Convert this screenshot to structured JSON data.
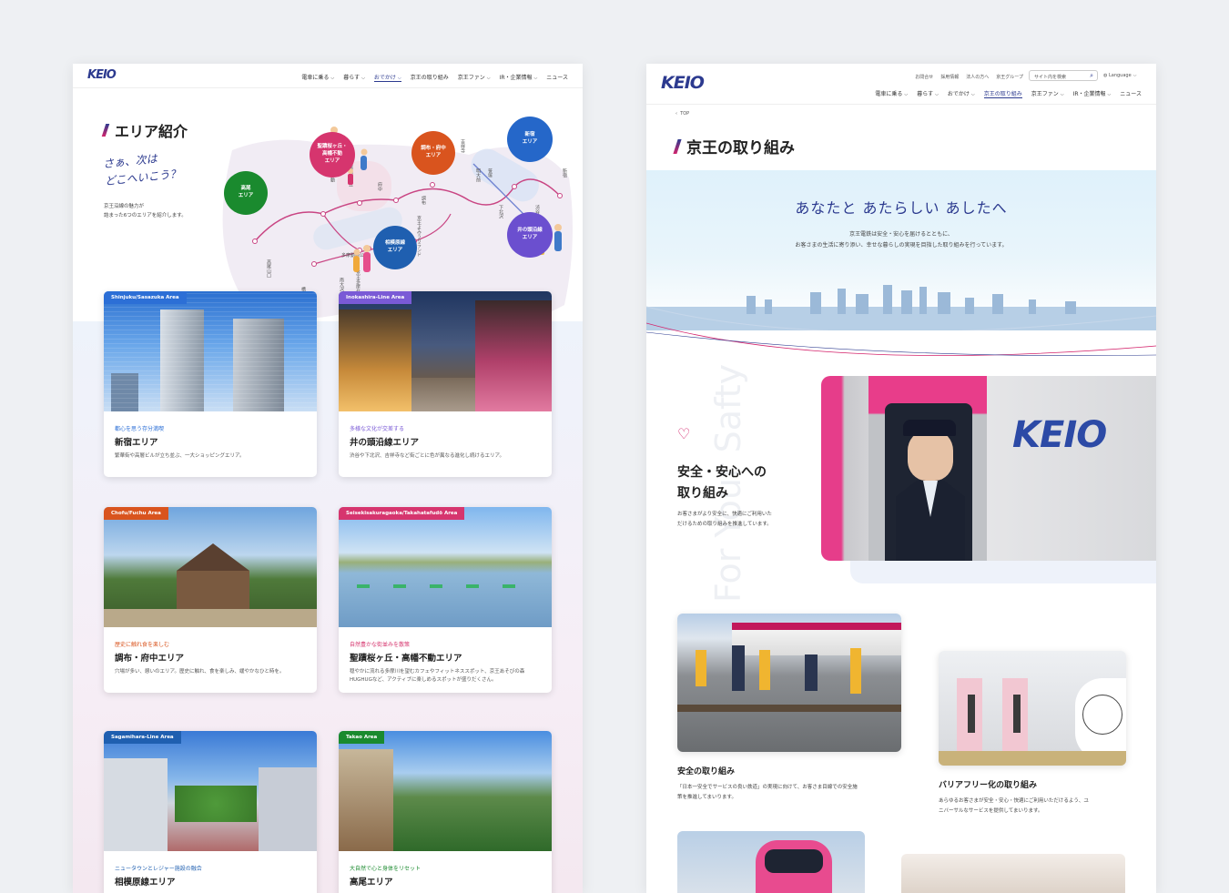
{
  "left": {
    "logo": "KEIO",
    "nav": [
      "電車に乗る",
      "暮らす",
      "おでかけ",
      "京王の取り組み",
      "京王ファン",
      "IR・企業情報",
      "ニュース"
    ],
    "title": "エリア紹介",
    "tagline": [
      "さぁ、次は",
      "どこへいこう？"
    ],
    "intro": [
      "京王沿線の魅力が",
      "詰まった6つのエリアを紹介します。"
    ],
    "bubbles": [
      {
        "label": "高尾\nエリア",
        "color": "#1a8a2e"
      },
      {
        "label": "聖蹟桜ヶ丘・\n高幡不動\nエリア",
        "color": "#d6356e"
      },
      {
        "label": "調布・府中\nエリア",
        "color": "#d9541e"
      },
      {
        "label": "新宿\nエリア",
        "color": "#2567c9"
      },
      {
        "label": "井の頭沿線\nエリア",
        "color": "#6b4fcf"
      },
      {
        "label": "相模原線\nエリア",
        "color": "#1f5fb0"
      }
    ],
    "stations": [
      "高尾山口",
      "高幡不動",
      "聖蹟桜ヶ丘",
      "府中",
      "調布",
      "明大前",
      "笹塚",
      "新宿",
      "吉祥寺",
      "下北沢",
      "渋谷",
      "多摩動物公園",
      "京王多摩センター",
      "京王よみうりランド",
      "南大沢",
      "橋本"
    ],
    "cards": [
      {
        "tag": "Shinjuku/Sasazuka Area",
        "tagColor": "#2c6fd6",
        "cat": "都心を思う存分満喫",
        "catColor": "#2c6fd6",
        "name": "新宿エリア",
        "desc": "繁華街や高層ビルが立ち並ぶ、一大ショッピングエリア。"
      },
      {
        "tag": "Inokashira-Line Area",
        "tagColor": "#7a5ad6",
        "cat": "多様な文化が交差する",
        "catColor": "#7a5ad6",
        "name": "井の頭沿線エリア",
        "desc": "渋谷や下北沢、吉祥寺など街ごとに色が異なる進化し続けるエリア。"
      },
      {
        "tag": "Chofu/Fuchu Area",
        "tagColor": "#d9541e",
        "cat": "歴史に触れ食を楽しむ",
        "catColor": "#d9541e",
        "name": "調布・府中エリア",
        "desc": "穴場が多い、憩いのエリア。歴史に触れ、食を楽しみ、緩やかなひと時を。"
      },
      {
        "tag": "Seisekisakuragaoka/Takahatafudō Area",
        "tagColor": "#d6356e",
        "cat": "自然豊かな街並みを散策",
        "catColor": "#d6356e",
        "name": "聖蹟桜ヶ丘・高幡不動エリア",
        "desc": "穏やかに流れる多摩川を望むカフェやフィットネススポット、京王あそびの森 HUGHUGなど、アクティブに楽しめるスポットが盛りだくさん。"
      },
      {
        "tag": "Sagamihara-Line Area",
        "tagColor": "#1f5fb0",
        "cat": "ニュータウンとレジャー施設の融合",
        "catColor": "#1f5fb0",
        "name": "相模原線エリア",
        "desc": ""
      },
      {
        "tag": "Takao Area",
        "tagColor": "#1a8a2e",
        "cat": "大自然で心と身体をリセット",
        "catColor": "#1a8a2e",
        "name": "高尾エリア",
        "desc": ""
      }
    ]
  },
  "right": {
    "logo": "KEIO",
    "util": [
      "お問合せ",
      "採用情報",
      "法人の方へ",
      "京王グループ"
    ],
    "search_placeholder": "サイト内を検索",
    "language": "Language",
    "nav": [
      "電車に乗る",
      "暮らす",
      "おでかけ",
      "京王の取り組み",
      "京王ファン",
      "IR・企業情報",
      "ニュース"
    ],
    "breadcrumb": "TOP",
    "title": "京王の取り組み",
    "hero_heading": "あなたと あたらしい あしたへ",
    "hero_text": [
      "京王電鉄は安全・安心を届けるとともに、",
      "お客さまの生活に寄り添い、幸せな暮らしの実現を目指した取り組みを行っています。"
    ],
    "vertical_text": "For Your Safty",
    "safety_heading": [
      "安全・安心への",
      "取り組み"
    ],
    "safety_text": [
      "お客さまがより安全に、快適にご利用いた",
      "だけるための取り組みを推進しています。"
    ],
    "train_logo": "KEIO",
    "item1": {
      "title": "安全の取り組み",
      "desc": [
        "「日本一安全でサービスの良い鉄道」の実現に向けて、お客さま目線での安全施",
        "策を推進してまいります。"
      ]
    },
    "item2": {
      "title": "バリアフリー化の取り組み",
      "desc": [
        "あらゆるお客さまが安全・安心・快適にご利用いただけるよう、ユ",
        "ニバーサルなサービスを提供してまいります。"
      ]
    }
  },
  "colors": {
    "brand": "#2c3a8f",
    "accent": "#d4246c"
  }
}
